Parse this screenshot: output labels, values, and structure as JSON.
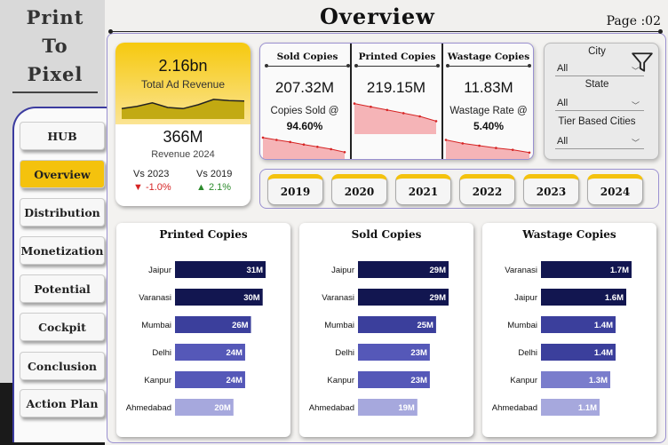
{
  "brand": {
    "line1": "Print",
    "line2": "To",
    "line3": "Pixel"
  },
  "header": {
    "title": "Overview",
    "page_label": "Page :02"
  },
  "nav": {
    "items": [
      {
        "label": "HUB",
        "active": false
      },
      {
        "label": "Overview",
        "active": true
      },
      {
        "label": "Distribution",
        "active": false
      },
      {
        "label": "Monetization",
        "active": false
      },
      {
        "label": "Potential",
        "active": false
      },
      {
        "label": "Cockpit",
        "active": false
      },
      {
        "label": "Conclusion",
        "active": false
      },
      {
        "label": "Action Plan",
        "active": false
      }
    ]
  },
  "revenue": {
    "value": "2.16bn",
    "label": "Total Ad Revenue",
    "value_2024": "366M",
    "label_2024": "Revenue 2024",
    "vs_2023_label": "Vs 2023",
    "vs_2023_value": "-1.0%",
    "vs_2019_label": "Vs 2019",
    "vs_2019_value": "2.1%",
    "trend": [
      0.45,
      0.55,
      0.7,
      0.5,
      0.45,
      0.62,
      0.85,
      0.8,
      0.78
    ]
  },
  "kpis": [
    {
      "title": "Sold Copies",
      "value": "207.32M",
      "sub": "Copies Sold @",
      "pct": "94.60%",
      "trend": [
        0.85,
        0.75,
        0.66,
        0.55,
        0.45,
        0.35,
        0.22
      ]
    },
    {
      "title": "Printed Copies",
      "value": "219.15M",
      "sub": "",
      "pct": "",
      "trend": [
        0.9,
        0.8,
        0.7,
        0.6,
        0.5,
        0.35
      ]
    },
    {
      "title": "Wastage Copies",
      "value": "11.83M",
      "sub": "Wastage Rate @",
      "pct": "5.40%",
      "trend": [
        0.75,
        0.6,
        0.5,
        0.4,
        0.32,
        0.2
      ]
    }
  ],
  "filters": [
    {
      "label": "City",
      "value": "All"
    },
    {
      "label": "State",
      "value": "All"
    },
    {
      "label": "Tier Based Cities",
      "value": "All"
    }
  ],
  "years": [
    "2019",
    "2020",
    "2021",
    "2022",
    "2023",
    "2024"
  ],
  "chart_data": [
    {
      "type": "bar",
      "title": "Printed Copies",
      "categories": [
        "Jaipur",
        "Varanasi",
        "Mumbai",
        "Delhi",
        "Kanpur",
        "Ahmedabad"
      ],
      "values": [
        31,
        30,
        26,
        24,
        24,
        20
      ],
      "labels": [
        "31M",
        "30M",
        "26M",
        "24M",
        "24M",
        "20M"
      ],
      "colors": [
        "#121650",
        "#121650",
        "#3b3f9c",
        "#5558b8",
        "#5558b8",
        "#a6a8dd"
      ]
    },
    {
      "type": "bar",
      "title": "Sold Copies",
      "categories": [
        "Jaipur",
        "Varanasi",
        "Mumbai",
        "Delhi",
        "Kanpur",
        "Ahmedabad"
      ],
      "values": [
        29,
        29,
        25,
        23,
        23,
        19
      ],
      "labels": [
        "29M",
        "29M",
        "25M",
        "23M",
        "23M",
        "19M"
      ],
      "colors": [
        "#121650",
        "#121650",
        "#3b3f9c",
        "#5558b8",
        "#5558b8",
        "#a6a8dd"
      ]
    },
    {
      "type": "bar",
      "title": "Wastage Copies",
      "categories": [
        "Varanasi",
        "Jaipur",
        "Mumbai",
        "Delhi",
        "Kanpur",
        "Ahmedabad"
      ],
      "values": [
        1.7,
        1.6,
        1.4,
        1.4,
        1.3,
        1.1
      ],
      "labels": [
        "1.7M",
        "1.6M",
        "1.4M",
        "1.4M",
        "1.3M",
        "1.1M"
      ],
      "colors": [
        "#121650",
        "#121650",
        "#3b3f9c",
        "#3b3f9c",
        "#7a7dcc",
        "#a6a8dd"
      ]
    }
  ]
}
